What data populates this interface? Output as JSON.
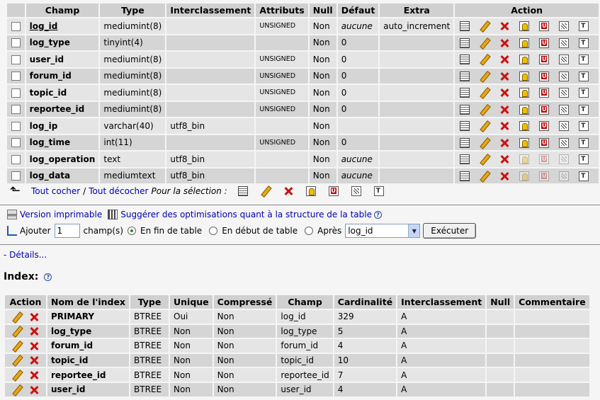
{
  "structure": {
    "headers": [
      "Champ",
      "Type",
      "Interclassement",
      "Attributs",
      "Null",
      "Défaut",
      "Extra",
      "Action"
    ],
    "rows": [
      {
        "field": "log_id",
        "type": "mediumint(8)",
        "collation": "",
        "attributes": "UNSIGNED",
        "null": "Non",
        "default": "aucune",
        "extra": "auto_increment",
        "default_italic": true,
        "primary": true
      },
      {
        "field": "log_type",
        "type": "tinyint(4)",
        "collation": "",
        "attributes": "",
        "null": "Non",
        "default": "0",
        "extra": ""
      },
      {
        "field": "user_id",
        "type": "mediumint(8)",
        "collation": "",
        "attributes": "UNSIGNED",
        "null": "Non",
        "default": "0",
        "extra": ""
      },
      {
        "field": "forum_id",
        "type": "mediumint(8)",
        "collation": "",
        "attributes": "UNSIGNED",
        "null": "Non",
        "default": "0",
        "extra": ""
      },
      {
        "field": "topic_id",
        "type": "mediumint(8)",
        "collation": "",
        "attributes": "UNSIGNED",
        "null": "Non",
        "default": "0",
        "extra": ""
      },
      {
        "field": "reportee_id",
        "type": "mediumint(8)",
        "collation": "",
        "attributes": "UNSIGNED",
        "null": "Non",
        "default": "0",
        "extra": ""
      },
      {
        "field": "log_ip",
        "type": "varchar(40)",
        "collation": "utf8_bin",
        "attributes": "",
        "null": "Non",
        "default": "",
        "extra": ""
      },
      {
        "field": "log_time",
        "type": "int(11)",
        "collation": "",
        "attributes": "UNSIGNED",
        "null": "Non",
        "default": "0",
        "extra": ""
      },
      {
        "field": "log_operation",
        "type": "text",
        "collation": "utf8_bin",
        "attributes": "",
        "null": "Non",
        "default": "aucune",
        "extra": "",
        "default_italic": true,
        "text_type": true
      },
      {
        "field": "log_data",
        "type": "mediumtext",
        "collation": "utf8_bin",
        "attributes": "",
        "null": "Non",
        "default": "aucune",
        "extra": "",
        "default_italic": true,
        "text_type": true
      }
    ]
  },
  "selection": {
    "check_all": "Tout cocher",
    "separator": "/",
    "uncheck_all": "Tout décocher",
    "for_selection": "Pour la sélection :"
  },
  "links": {
    "print_view": "Version imprimable",
    "propose_structure": "Suggérer des optimisations quant à la structure de la table"
  },
  "add_fields": {
    "label": "Ajouter",
    "count": "1",
    "unit": "champ(s)",
    "at_end": "En fin de table",
    "at_start": "En début de table",
    "after": "Après",
    "after_field": "log_id",
    "execute": "Exécuter"
  },
  "details_link": "- Détails...",
  "index": {
    "title": "Index:",
    "headers": [
      "Action",
      "Nom de l'index",
      "Type",
      "Unique",
      "Compressé",
      "Champ",
      "Cardinalité",
      "Interclassement",
      "Null",
      "Commentaire"
    ],
    "rows": [
      {
        "name": "PRIMARY",
        "type": "BTREE",
        "unique": "Oui",
        "packed": "Non",
        "column": "log_id",
        "cardinality": "329",
        "collation": "A",
        "null": "",
        "comment": ""
      },
      {
        "name": "log_type",
        "type": "BTREE",
        "unique": "Non",
        "packed": "Non",
        "column": "log_type",
        "cardinality": "5",
        "collation": "A",
        "null": "",
        "comment": ""
      },
      {
        "name": "forum_id",
        "type": "BTREE",
        "unique": "Non",
        "packed": "Non",
        "column": "forum_id",
        "cardinality": "4",
        "collation": "A",
        "null": "",
        "comment": ""
      },
      {
        "name": "topic_id",
        "type": "BTREE",
        "unique": "Non",
        "packed": "Non",
        "column": "topic_id",
        "cardinality": "10",
        "collation": "A",
        "null": "",
        "comment": ""
      },
      {
        "name": "reportee_id",
        "type": "BTREE",
        "unique": "Non",
        "packed": "Non",
        "column": "reportee_id",
        "cardinality": "7",
        "collation": "A",
        "null": "",
        "comment": ""
      },
      {
        "name": "user_id",
        "type": "BTREE",
        "unique": "Non",
        "packed": "Non",
        "column": "user_id",
        "cardinality": "4",
        "collation": "A",
        "null": "",
        "comment": ""
      }
    ]
  },
  "icons": {
    "row_actions": [
      "browse-icon",
      "edit-icon",
      "delete-icon",
      "primary-key-icon",
      "unique-icon",
      "index-icon",
      "fulltext-icon"
    ],
    "index_actions": [
      "edit-icon",
      "delete-icon"
    ]
  },
  "colors": {
    "header_bg": "#d0d0d0",
    "row_odd": "#e5e5e5",
    "row_even": "#d5d5d5",
    "page_bg": "#f5f5f5",
    "link": "#0000aa"
  }
}
